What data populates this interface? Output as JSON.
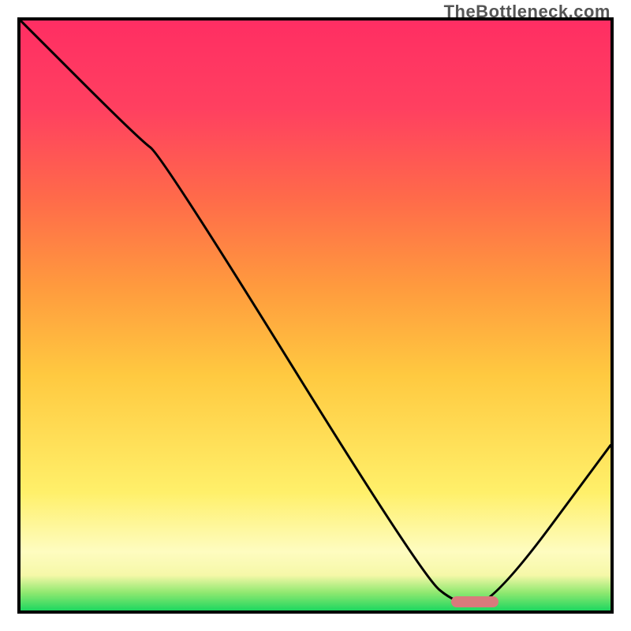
{
  "watermark": "TheBottleneck.com",
  "chart_data": {
    "type": "line",
    "title": "",
    "xlabel": "",
    "ylabel": "",
    "xlim": [
      0,
      100
    ],
    "ylim": [
      0,
      100
    ],
    "x": [
      0,
      20,
      24,
      68,
      74,
      80,
      100
    ],
    "values": [
      100,
      80,
      77,
      6,
      1,
      1,
      28
    ],
    "marker": {
      "x_start": 73,
      "x_end": 81,
      "y": 1.5,
      "color": "#D97A7C"
    },
    "gradient_stops": [
      {
        "pos": 0.0,
        "color": "#1ED760"
      },
      {
        "pos": 0.03,
        "color": "#8FE870"
      },
      {
        "pos": 0.06,
        "color": "#F6F8A8"
      },
      {
        "pos": 0.1,
        "color": "#FEFCC0"
      },
      {
        "pos": 0.2,
        "color": "#FFF06A"
      },
      {
        "pos": 0.4,
        "color": "#FFC940"
      },
      {
        "pos": 0.55,
        "color": "#FF9A3E"
      },
      {
        "pos": 0.7,
        "color": "#FF6A4A"
      },
      {
        "pos": 0.85,
        "color": "#FF4060"
      },
      {
        "pos": 1.0,
        "color": "#FF2E63"
      }
    ]
  }
}
